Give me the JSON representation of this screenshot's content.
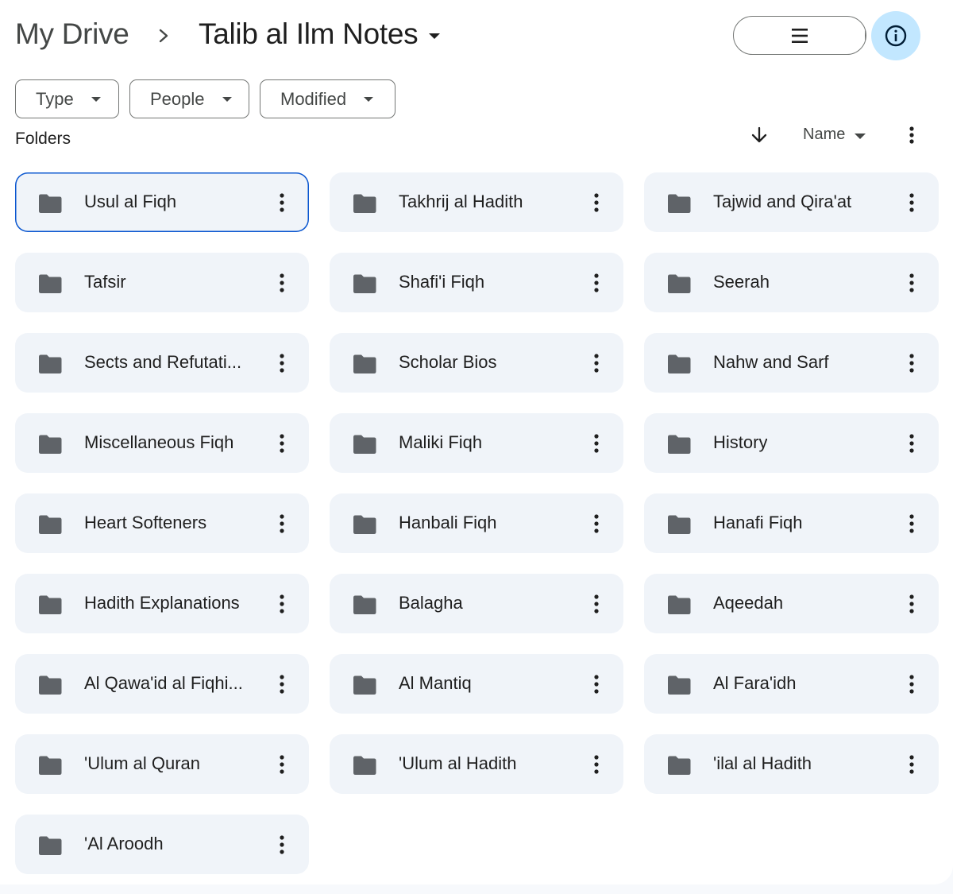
{
  "header": {
    "breadcrumb_root": "My Drive",
    "breadcrumb_separator_icon": "chevron-right-icon",
    "current_folder": "Talib al Ilm Notes",
    "view_toggle": {
      "list_icon": "list-view-icon",
      "grid_check_icon": "check-icon",
      "grid_icon": "grid-view-icon",
      "active": "grid"
    },
    "info_icon": "info-icon"
  },
  "filters": [
    {
      "label": "Type"
    },
    {
      "label": "People"
    },
    {
      "label": "Modified"
    }
  ],
  "section": {
    "title": "Folders",
    "sort_direction_icon": "arrow-down-icon",
    "sort_label": "Name",
    "more_icon": "more-vert-icon"
  },
  "colors": {
    "accent": "#0b57d0",
    "active_toggle": "#c2e7ff",
    "card_bg": "#f0f4f9",
    "folder_icon": "#5f6368"
  },
  "folders": [
    {
      "name": "Usul al Fiqh",
      "selected": true
    },
    {
      "name": "Takhrij al Hadith"
    },
    {
      "name": "Tajwid and Qira'at"
    },
    {
      "name": "Tafsir"
    },
    {
      "name": "Shafi'i Fiqh"
    },
    {
      "name": "Seerah"
    },
    {
      "name": "Sects and Refutati..."
    },
    {
      "name": "Scholar Bios"
    },
    {
      "name": "Nahw and Sarf"
    },
    {
      "name": "Miscellaneous Fiqh"
    },
    {
      "name": "Maliki Fiqh"
    },
    {
      "name": "History"
    },
    {
      "name": "Heart Softeners"
    },
    {
      "name": "Hanbali Fiqh"
    },
    {
      "name": "Hanafi Fiqh"
    },
    {
      "name": "Hadith Explanations"
    },
    {
      "name": "Balagha"
    },
    {
      "name": "Aqeedah"
    },
    {
      "name": "Al Qawa'id al Fiqhi..."
    },
    {
      "name": "Al Mantiq"
    },
    {
      "name": "Al Fara'idh"
    },
    {
      "name": "'Ulum al Quran"
    },
    {
      "name": "'Ulum al Hadith"
    },
    {
      "name": "'ilal al Hadith"
    },
    {
      "name": "'Al Aroodh"
    }
  ]
}
